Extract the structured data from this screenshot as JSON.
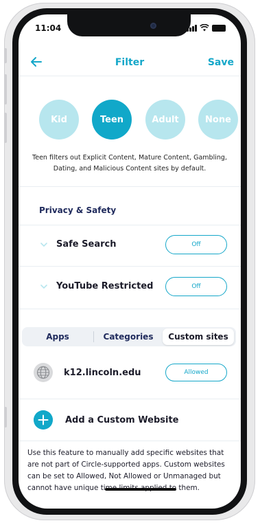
{
  "status": {
    "time": "11:04"
  },
  "header": {
    "title": "Filter",
    "save_label": "Save",
    "back_icon": "arrow-left-icon"
  },
  "age_filters": {
    "options": [
      "Kid",
      "Teen",
      "Adult",
      "None"
    ],
    "selected": "Teen"
  },
  "description": "Teen filters out Explicit Content, Mature Content, Gambling, Dating, and Malicious Content sites by default.",
  "privacy": {
    "title": "Privacy & Safety",
    "items": [
      {
        "label": "Safe Search",
        "value": "Off"
      },
      {
        "label": "YouTube Restricted",
        "value": "Off"
      }
    ]
  },
  "tabs": {
    "items": [
      "Apps",
      "Categories",
      "Custom sites"
    ],
    "selected": "Custom sites"
  },
  "custom_sites": [
    {
      "name": "k12.lincoln.edu",
      "status": "Allowed",
      "icon": "globe-icon"
    }
  ],
  "add_site": {
    "label": "Add a Custom Website",
    "icon": "plus-icon"
  },
  "info_text": "Use this feature to manually add specific websites that are not part of Circle-supported apps. Custom websites can be set to Allowed, Not Allowed or Unmanaged but cannot have unique time limits applied to them.",
  "colors": {
    "accent": "#11a8c9",
    "accent_light": "#b7e6ee",
    "navy": "#1f2a5c"
  }
}
